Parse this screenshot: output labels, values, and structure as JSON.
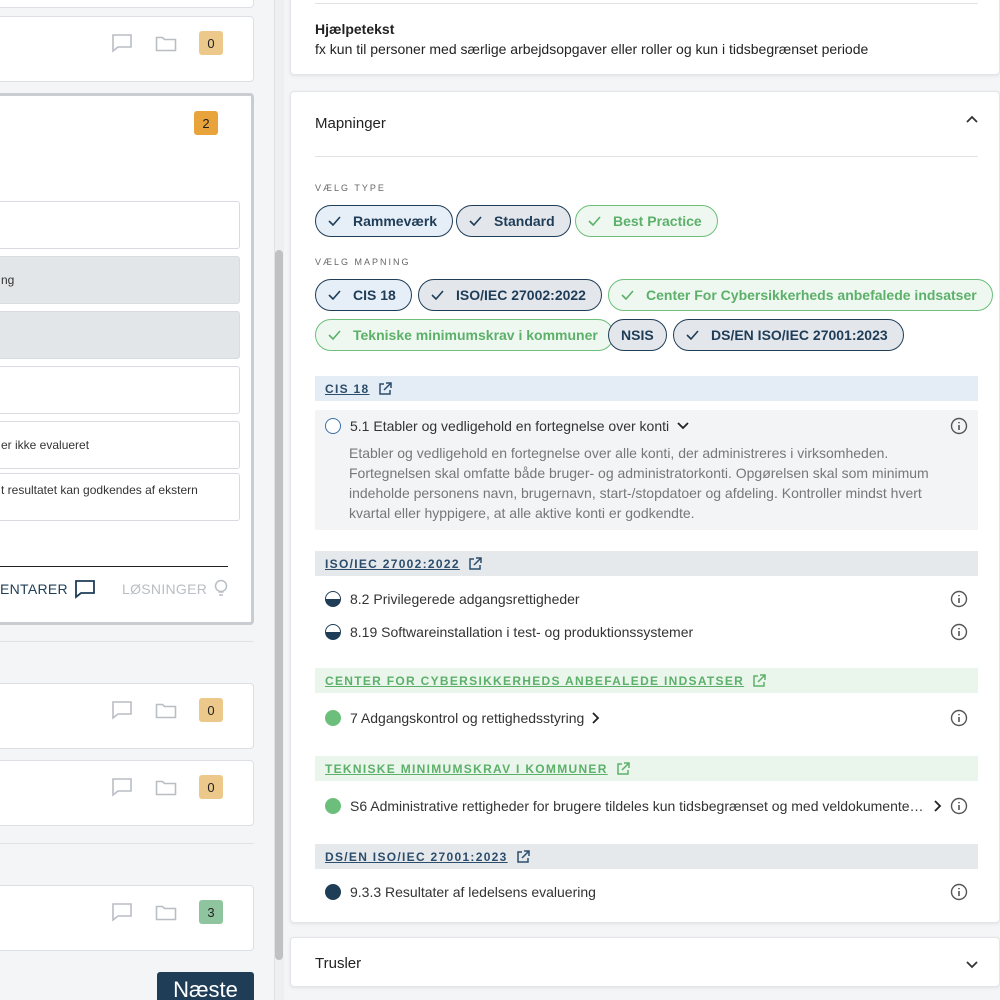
{
  "left": {
    "cards": [
      {
        "badge": "0"
      },
      {
        "badge": "2"
      },
      {
        "badge": "0"
      },
      {
        "badge": "0"
      },
      {
        "badge": "3"
      }
    ],
    "options": [
      "",
      "ng",
      "",
      "",
      "er ikke evalueret",
      "t resultatet kan godkendes af ekstern"
    ],
    "comments_label": "ENTARER",
    "solutions_label": "LØSNINGER",
    "next_button": "Næste"
  },
  "help": {
    "title": "Hjælpetekst",
    "text": "fx kun til personer med særlige arbejdsopgaver eller roller og kun i tidsbegrænset periode"
  },
  "mappings": {
    "title": "Mapninger",
    "type_label": "VÆLG TYPE",
    "types": [
      "Rammeværk",
      "Standard",
      "Best Practice"
    ],
    "mapping_label": "VÆLG MAPNING",
    "mappings": [
      "CIS 18",
      "ISO/IEC 27002:2022",
      "Center For Cybersikkerheds anbefalede indsatser",
      "Tekniske minimumskrav i kommuner",
      "NSIS",
      "DS/EN ISO/IEC 27001:2023"
    ],
    "sections": [
      {
        "title": "CIS 18",
        "items": [
          {
            "label": "5.1 Etabler og vedligehold en fortegnelse over konti",
            "description": [
              "Etabler og vedligehold en fortegnelse over alle konti, der administreres i virksomheden.",
              "Fortegnelsen skal omfatte både bruger- og administratorkonti. Opgørelsen skal som minimum",
              "indeholde personens navn, brugernavn, start-/stopdatoer og afdeling. Kontroller mindst hvert",
              "kvartal eller hyppigere, at alle aktive konti er godkendte."
            ]
          }
        ]
      },
      {
        "title": "ISO/IEC 27002:2022",
        "items": [
          {
            "label": "8.2 Privilegerede adgangsrettigheder"
          },
          {
            "label": "8.19 Softwareinstallation i test- og produktionssystemer"
          }
        ]
      },
      {
        "title": "CENTER FOR CYBERSIKKERHEDS ANBEFALEDE INDSATSER",
        "items": [
          {
            "label": "7 Adgangskontrol og rettighedsstyring"
          }
        ]
      },
      {
        "title": "TEKNISKE MINIMUMSKRAV I KOMMUNER",
        "items": [
          {
            "label": "S6 Administrative rettigheder for brugere tildeles kun tidsbegrænset og med veldokumente…"
          }
        ]
      },
      {
        "title": "DS/EN ISO/IEC 27001:2023",
        "items": [
          {
            "label": "9.3.3 Resultater af ledelsens evaluering"
          }
        ]
      }
    ]
  },
  "threats": {
    "title": "Trusler"
  },
  "colors": {
    "navy": "#1f3d57",
    "green": "#6cbf7a",
    "orange": "#e8a33a",
    "tan": "#ecc98a"
  }
}
